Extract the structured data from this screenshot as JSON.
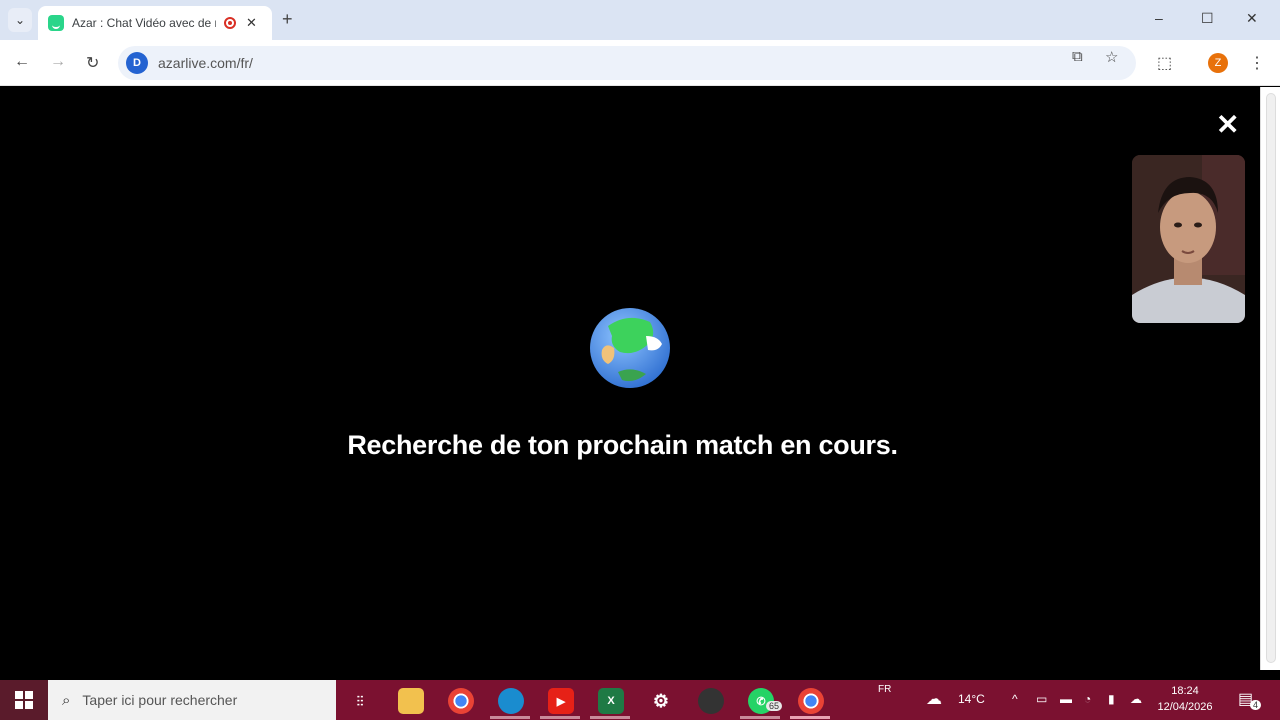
{
  "browser": {
    "tab": {
      "title": "Azar : Chat Vidéo avec de n"
    },
    "new_tab_label": "+",
    "window_controls": {
      "minimize": "–",
      "maximize": "☐",
      "close": "✕"
    },
    "url": "azarlive.com/fr/",
    "site_icon_letter": "D",
    "profile_initial": "Z"
  },
  "page": {
    "status_text": "Recherche de ton prochain match en cours.",
    "close_label": "✕"
  },
  "taskbar": {
    "search_placeholder": "Taper ici pour rechercher",
    "whatsapp_badge": "65",
    "language": "FR",
    "weather_temp": "14°C",
    "time": "18:24",
    "date": "12/04/2026",
    "notification_count": "4"
  },
  "colors": {
    "accent_green": "#2ad58a",
    "tab_strip_bg": "#dbe4f3",
    "taskbar_bg": "#7b1130",
    "profile_orange": "#e8710a"
  }
}
